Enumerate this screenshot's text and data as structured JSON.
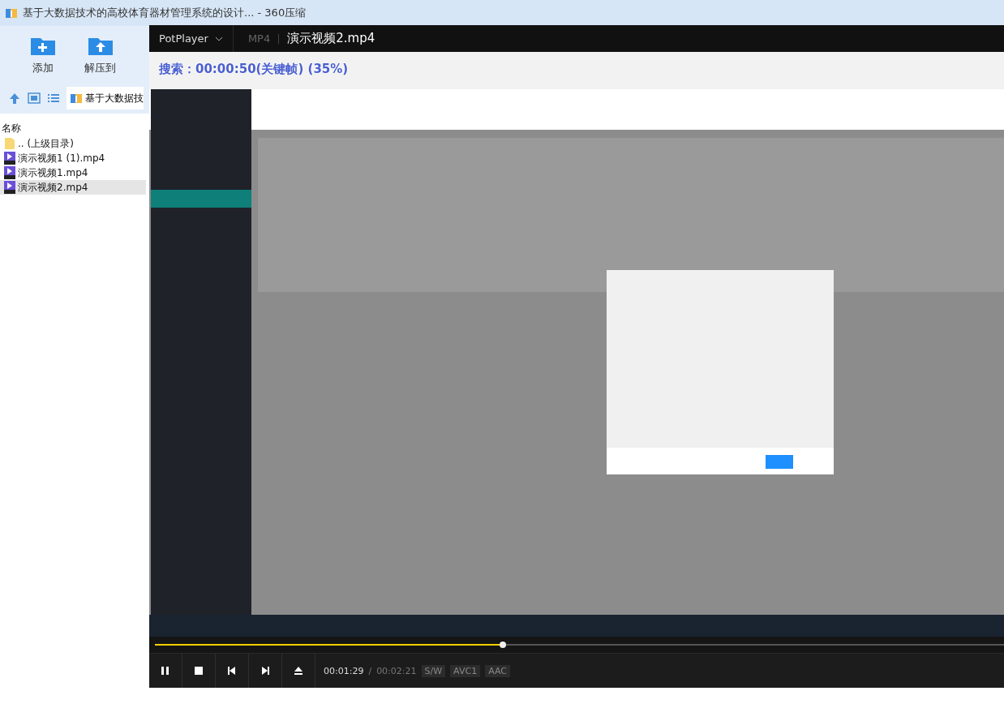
{
  "window": {
    "title": "基于大数据技术的高校体育器材管理系统的设计... - 360压缩"
  },
  "toolbar": [
    {
      "label": "添加",
      "kind": "add"
    },
    {
      "label": "解压到",
      "kind": "extract"
    }
  ],
  "address": {
    "path": "基于大数据技"
  },
  "file_list": {
    "columns": [
      "名称"
    ],
    "rows": [
      {
        "name": ".. (上级目录)",
        "kind": "folder",
        "selected": false
      },
      {
        "name": "演示视频1 (1).mp4",
        "kind": "video",
        "selected": false
      },
      {
        "name": "演示视频1.mp4",
        "kind": "video",
        "selected": false
      },
      {
        "name": "演示视频2.mp4",
        "kind": "video",
        "selected": true
      }
    ]
  },
  "player": {
    "app": "PotPlayer",
    "format": "MP4",
    "file": "演示视频2.mp4",
    "osd": "搜索：00:00:50(关键帧) (35%)",
    "progress": {
      "level": 0.41
    },
    "controls": [
      {
        "kind": "pause"
      },
      {
        "kind": "stop"
      },
      {
        "kind": "previous"
      },
      {
        "kind": "next"
      },
      {
        "kind": "eject"
      }
    ],
    "time_current": "00:01:29",
    "time_separator": "/",
    "time_total": "00:02:21",
    "badges": [
      "S/W",
      "AVC1",
      "AAC"
    ]
  }
}
